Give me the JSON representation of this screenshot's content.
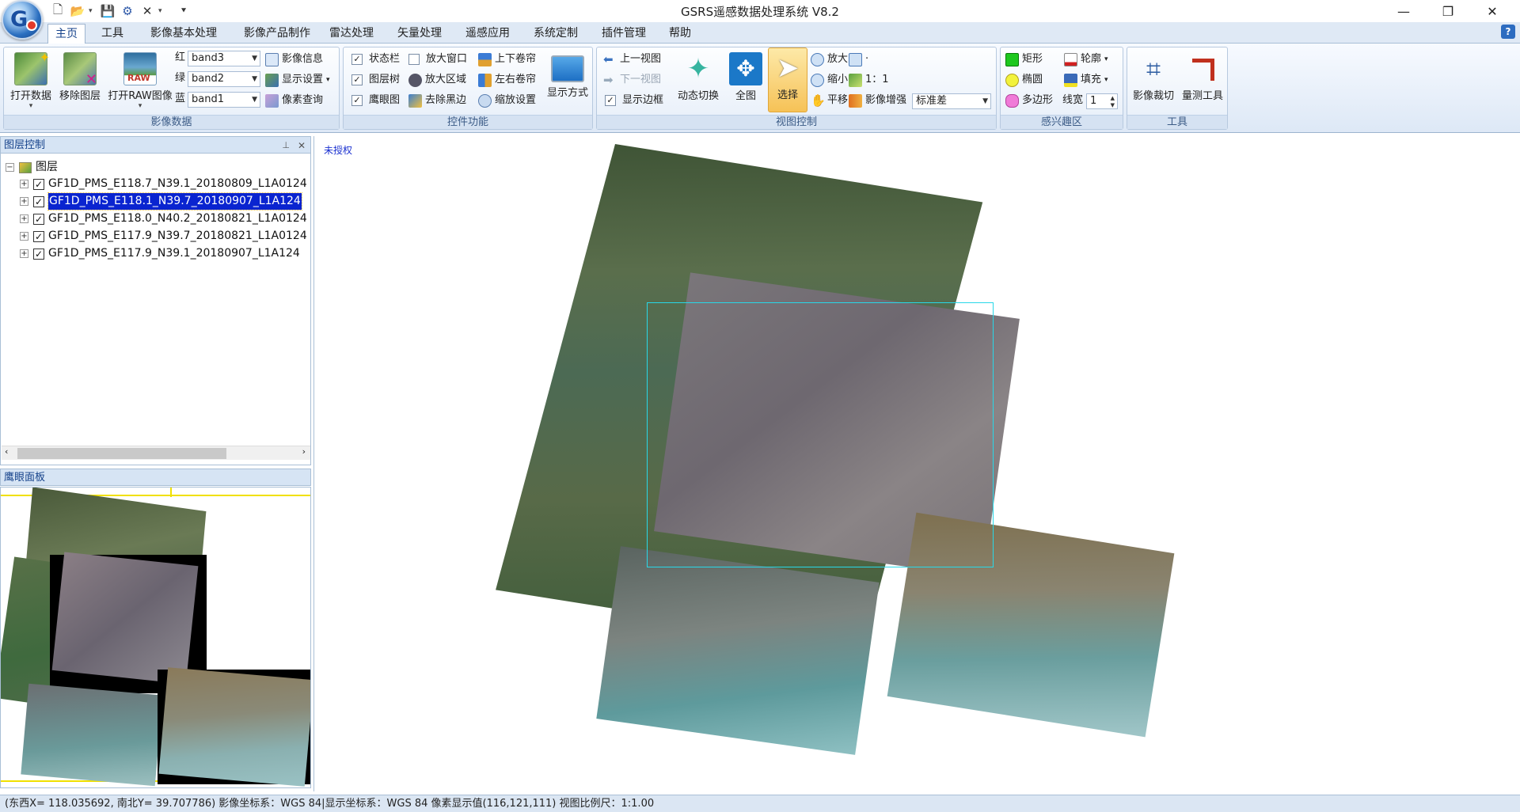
{
  "app": {
    "title": "GSRS遥感数据处理系统 V8.2",
    "logo_letter": "G"
  },
  "qat_icons": [
    "new-file-icon",
    "open-folder-icon",
    "save-icon",
    "settings-gear-icon",
    "close-x-icon",
    "customize-icon"
  ],
  "window_controls": {
    "minimize": "—",
    "restore": "❐",
    "close": "✕"
  },
  "tabs": [
    "主页",
    "工具",
    "影像基本处理",
    "影像产品制作",
    "雷达处理",
    "矢量处理",
    "遥感应用",
    "系统定制",
    "插件管理",
    "帮助"
  ],
  "active_tab": "主页",
  "help_glyph": "?",
  "ribbon": {
    "image_data": {
      "label": "影像数据",
      "open_data": "打开数据",
      "remove_layer": "移除图层",
      "open_raw": "打开RAW图像",
      "raw_text": "RAW",
      "red_label": "红",
      "red_value": "band3",
      "green_label": "绿",
      "green_value": "band2",
      "blue_label": "蓝",
      "blue_value": "band1",
      "image_info": "影像信息",
      "display_settings": "显示设置",
      "pixel_query": "像素查询"
    },
    "controls": {
      "label": "控件功能",
      "status_bar": "状态栏",
      "status_bar_checked": true,
      "layer_tree": "图层树",
      "layer_tree_checked": true,
      "eagle_eye": "鹰眼图",
      "eagle_eye_checked": true,
      "zoom_window": "放大窗口",
      "zoom_window_checked": false,
      "zoom_area": "放大区域",
      "remove_black": "去除黑边",
      "tb_curtain": "上下卷帘",
      "lr_curtain": "左右卷帘",
      "zoom_settings": "缩放设置",
      "display_mode": "显示方式"
    },
    "view": {
      "label": "视图控制",
      "prev_view": "上一视图",
      "next_view": "下一视图",
      "show_border": "显示边框",
      "show_border_checked": true,
      "dynamic_switch": "动态切换",
      "full_view": "全图",
      "select": "选择",
      "zoom_in": "放大",
      "zoom_out": "缩小",
      "pan": "平移",
      "measure_dot": "·",
      "one_to_one": "1：1",
      "enhance_label": "影像增强",
      "enhance_value": "标准差"
    },
    "roi": {
      "label": "感兴趣区",
      "rectangle": "矩形",
      "ellipse": "椭圆",
      "polygon": "多边形",
      "outline": "轮廓",
      "fill": "填充",
      "line_width_label": "线宽",
      "line_width_value": "1"
    },
    "tools": {
      "label": "工具",
      "crop": "影像裁切",
      "measure": "量测工具"
    }
  },
  "layer_panel": {
    "title": "图层控制",
    "pin_glyph": "📌",
    "close_glyph": "✕",
    "root": "图层",
    "layers": [
      {
        "name": "GF1D_PMS_E118.7_N39.1_20180809_L1A0124",
        "checked": true,
        "selected": false
      },
      {
        "name": "GF1D_PMS_E118.1_N39.7_20180907_L1A124",
        "checked": true,
        "selected": true
      },
      {
        "name": "GF1D_PMS_E118.0_N40.2_20180821_L1A0124",
        "checked": true,
        "selected": false
      },
      {
        "name": "GF1D_PMS_E117.9_N39.7_20180821_L1A0124",
        "checked": true,
        "selected": false
      },
      {
        "name": "GF1D_PMS_E117.9_N39.1_20180907_L1A124",
        "checked": true,
        "selected": false
      }
    ]
  },
  "eye_panel": {
    "title": "鹰眼面板"
  },
  "map": {
    "watermark": "未授权"
  },
  "statusbar": {
    "text": "(东西X= 118.035692, 南北Y= 39.707786) 影像坐标系：WGS 84|显示坐标系：WGS 84 像素显示值(116,121,111)  视图比例尺：1:1.00"
  }
}
